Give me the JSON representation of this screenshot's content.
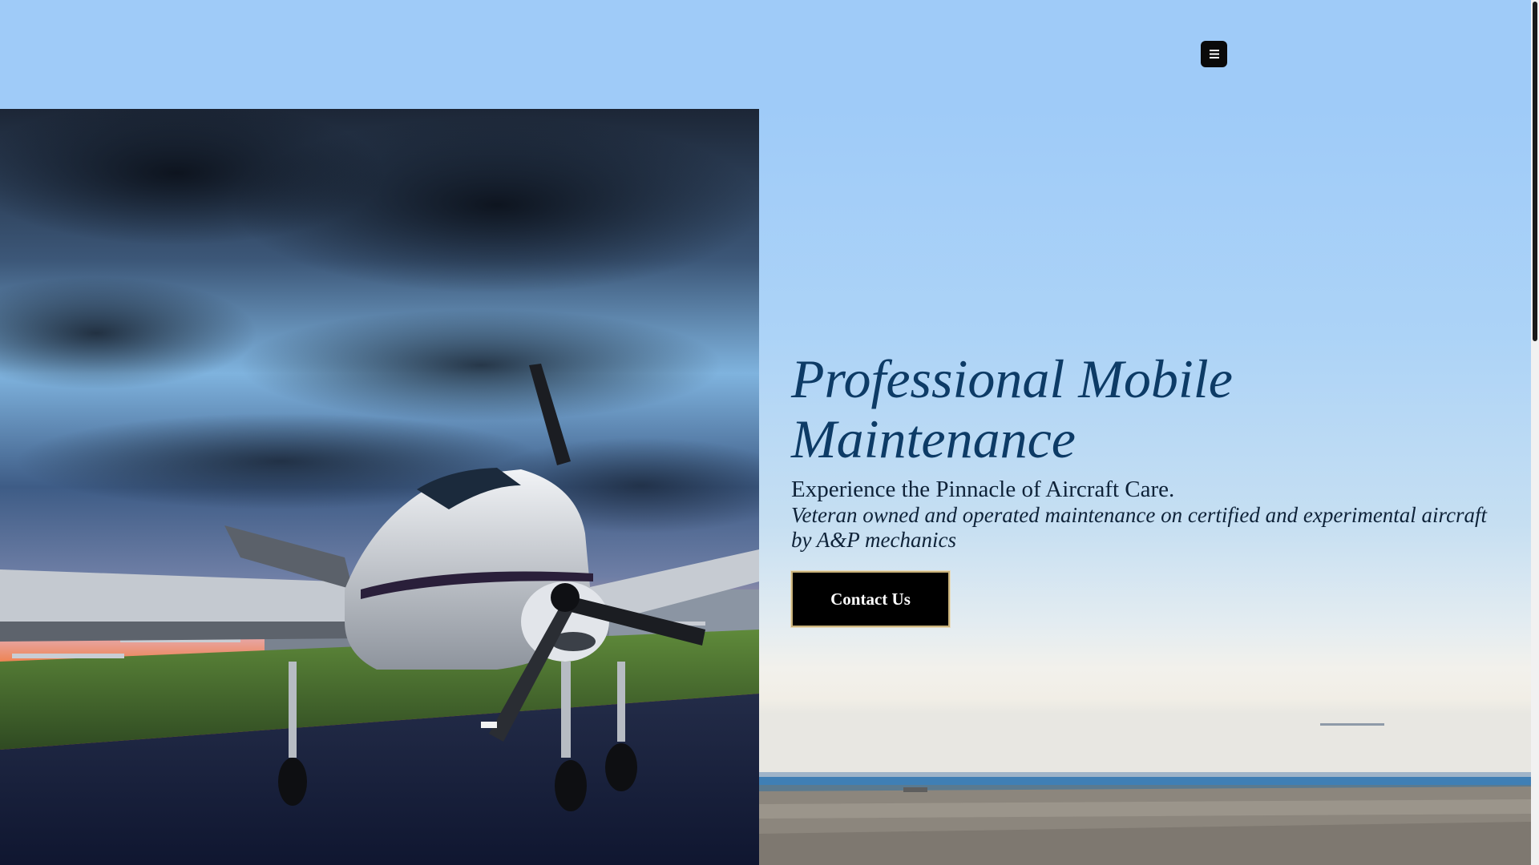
{
  "header": {
    "menu_icon": "hamburger-menu-icon"
  },
  "hero": {
    "title": "Professional Mobile Maintenance",
    "subtitle": "Experience the Pinnacle of Aircraft Care.",
    "tagline": "Veteran owned and operated maintenance on certified and experimental aircraft by A&P mechanics",
    "cta_label": "Contact Us"
  },
  "colors": {
    "header_background": "#9fcbf8",
    "title_color": "#0d3b66",
    "button_background": "#000000",
    "button_text": "#ffffff"
  }
}
